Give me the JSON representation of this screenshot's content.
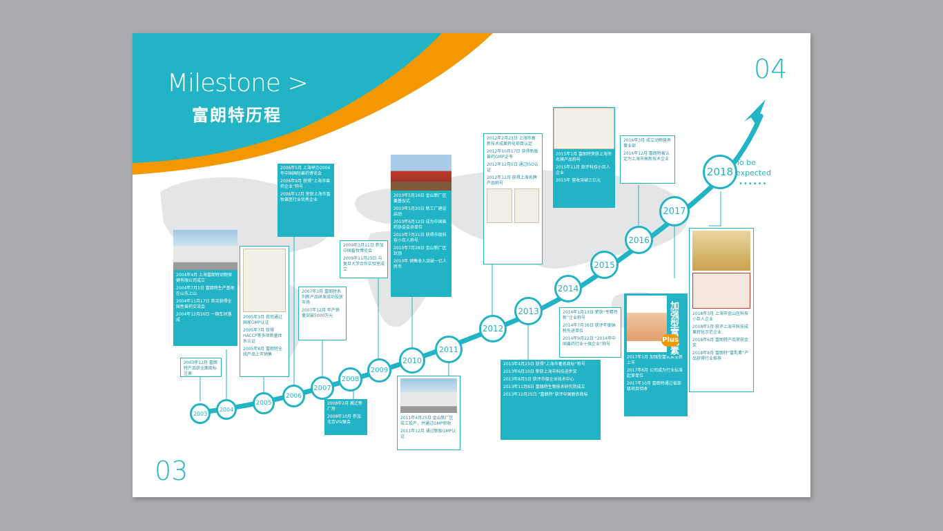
{
  "header": {
    "title_en": "Milestone",
    "title_cn": "富朗特历程"
  },
  "page_numbers": {
    "left": "03",
    "right": "04"
  },
  "future": {
    "label": "To be expected",
    "dots": "••••••"
  },
  "years": [
    "2003",
    "2004",
    "2005",
    "2006",
    "2007",
    "2008",
    "2009",
    "2010",
    "2011",
    "2012",
    "2013",
    "2014",
    "2015",
    "2016",
    "2017",
    "2018"
  ],
  "boxes": {
    "b2004": [
      "2004年4月 上海富朗特动物保健有限公司成立",
      "2004年7月1日 富朗特生产基地在山东上山",
      "2004年11月17日 首次获得全国性兽药交流会",
      "2004年12月20日 一期车间落成"
    ],
    "b2003": [
      "2003年12月 富朗特产品获全面商标注册"
    ],
    "b2005": [
      "2005年3月 我司通过国家GMP认证",
      "2005年7月 获得HACCP等多项质量体系认证",
      "2005年8月 富朗特全线产品上市销售"
    ],
    "b2006": [
      "2006年5月 上海举办2006年中国国际兽药博览会",
      "2006年9月 获得“上海市兽药企业”称号",
      "2006年12月 荣获上海市畜牧兽医行业优秀企业"
    ],
    "b2007": [
      "2007年3月 富朗特系列新产品研发成功投放市场",
      "2007年12月 年产销量突破5000万元"
    ],
    "b2008": [
      "2008年2月 搬迁新厂房",
      "2008年10月 参加北京VIV展会"
    ],
    "b2009": [
      "2009年3月11日 参加中国畜牧博览会",
      "2009年11月25日 与复旦大学合作实验室成立"
    ],
    "b2010": [
      "2010年5月16日 金山新厂区奠基仪式",
      "2010年5月20日 新工厂建设启动",
      "2010年6月12日 成为中国兽药协会会员单位",
      "2010年7月21日 获得市级科技小巨人称号",
      "2010年7月28日 金山新厂区封顶",
      "2010年 销售收入突破一亿人民币"
    ],
    "b2011": [
      "2011年4月25日 金山新厂区竣工投产，并通过GMP验收",
      "2011年12月 通过新版GMP认证"
    ],
    "b2012": [
      "2012年2月23日 上海市高新技术成果转化项目认定",
      "2012年10月17日 获得新版兽药GMP证书",
      "2012年12月5日 通过ISO认证",
      "2012年12月 获得上海名牌产品称号"
    ],
    "b2013": [
      "2013年4月23日 获得“上海市著名商标”称号",
      "2013年6月10日 荣获上海市科技进步奖",
      "2013年8月5日 获评市级企业技术中心",
      "2013年11月8日 富朗特生物技术研究院成立",
      "2013年12月25日 “富朗特”获评中国驰名商标"
    ],
    "b2014": [
      "2014年1月13日 荣获“专精特新”企业称号",
      "2014年7月16日 获评年度纳税先进单位",
      "2014年9月22日 “2014年中国兽药行业十强企业”称号"
    ],
    "b2015": [
      "2015年1月 富朗特荣获上海市名牌产品称号",
      "2015年11月 获评科技小巨人企业",
      "2015年 营收突破三亿元"
    ],
    "b2016": [
      "2016年3月 成立动物营养事业部",
      "2016年12月 富朗特被认定为上海市高新技术企业"
    ],
    "b2017": [
      "2017年1月 加强型富乳素全新上市",
      "2017年6月 公司成为行业标准起草单位",
      "2017年10月 富朗特通过省部级项目验收"
    ],
    "b2018": [
      "2018年3月 上海市金山区科技小巨人企业",
      "2018年5月 获评上海市科技成果转化示范企业",
      "2018年6月 富朗特产品荣获金奖",
      "2018年8月 富朗特“富乳素”产品获得行业推荐"
    ]
  },
  "product": {
    "tag": "加强型富乳素",
    "badge": "Plus"
  }
}
